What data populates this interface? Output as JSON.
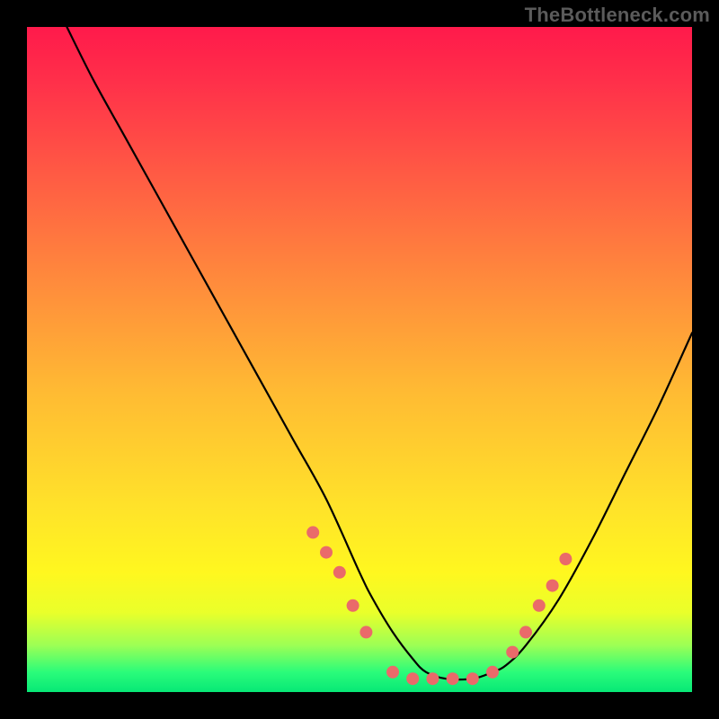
{
  "watermark": "TheBottleneck.com",
  "chart_data": {
    "type": "line",
    "title": "",
    "xlabel": "",
    "ylabel": "",
    "xlim": [
      0,
      100
    ],
    "ylim": [
      0,
      100
    ],
    "grid": false,
    "legend": false,
    "series": [
      {
        "name": "curve",
        "x": [
          6,
          10,
          15,
          20,
          25,
          30,
          35,
          40,
          45,
          50,
          52,
          55,
          58,
          60,
          63,
          67,
          70,
          72,
          75,
          80,
          85,
          90,
          95,
          100
        ],
        "y": [
          100,
          92,
          83,
          74,
          65,
          56,
          47,
          38,
          29,
          18,
          14,
          9,
          5,
          3,
          2,
          2,
          3,
          4,
          7,
          14,
          23,
          33,
          43,
          54
        ],
        "color": "#000000",
        "width": 2.2
      }
    ],
    "markers": {
      "name": "dots",
      "color": "#ea6a6a",
      "radius": 7,
      "points": [
        {
          "x": 43,
          "y": 24
        },
        {
          "x": 45,
          "y": 21
        },
        {
          "x": 47,
          "y": 18
        },
        {
          "x": 49,
          "y": 13
        },
        {
          "x": 51,
          "y": 9
        },
        {
          "x": 55,
          "y": 3
        },
        {
          "x": 58,
          "y": 2
        },
        {
          "x": 61,
          "y": 2
        },
        {
          "x": 64,
          "y": 2
        },
        {
          "x": 67,
          "y": 2
        },
        {
          "x": 70,
          "y": 3
        },
        {
          "x": 73,
          "y": 6
        },
        {
          "x": 75,
          "y": 9
        },
        {
          "x": 77,
          "y": 13
        },
        {
          "x": 79,
          "y": 16
        },
        {
          "x": 81,
          "y": 20
        }
      ]
    },
    "background_gradient": {
      "top": "#ff1a4b",
      "mid": "#ffe22a",
      "bottom": "#07e876"
    }
  }
}
